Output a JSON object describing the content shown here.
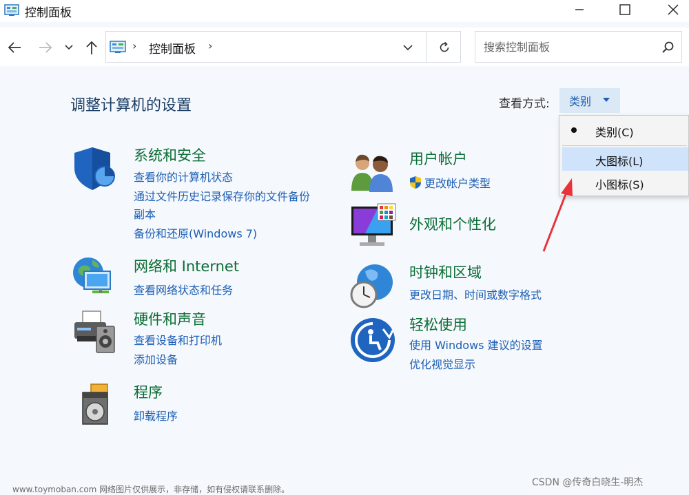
{
  "window": {
    "title": "控制面板"
  },
  "address": {
    "crumbs": [
      "控制面板"
    ]
  },
  "search": {
    "placeholder": "搜索控制面板"
  },
  "main": {
    "heading": "调整计算机的设置",
    "view_by_label": "查看方式:",
    "view_by_value": "类别"
  },
  "menu": {
    "items": [
      {
        "label": "类别(C)",
        "selected": true
      },
      {
        "label": "大图标(L)",
        "highlighted": true
      },
      {
        "label": "小图标(S)"
      }
    ]
  },
  "categories": [
    {
      "title": "系统和安全",
      "icon": "shield-icon",
      "links": [
        "查看你的计算机状态",
        "通过文件历史记录保存你的文件备份",
        "副本",
        "备份和还原(Windows 7)"
      ]
    },
    {
      "title": "网络和 Internet",
      "icon": "network-icon",
      "links": [
        "查看网络状态和任务"
      ]
    },
    {
      "title": "硬件和声音",
      "icon": "printer-icon",
      "links": [
        "查看设备和打印机",
        "添加设备"
      ]
    },
    {
      "title": "程序",
      "icon": "programs-icon",
      "links": [
        "卸载程序"
      ]
    },
    {
      "title": "用户帐户",
      "icon": "users-icon",
      "links": [
        "更改帐户类型"
      ]
    },
    {
      "title": "外观和个性化",
      "icon": "monitor-icon",
      "links": []
    },
    {
      "title": "时钟和区域",
      "icon": "clock-globe-icon",
      "links": [
        "更改日期、时间或数字格式"
      ]
    },
    {
      "title": "轻松使用",
      "icon": "accessibility-icon",
      "links": [
        "使用 Windows 建议的设置",
        "优化视觉显示"
      ]
    }
  ],
  "colors": {
    "link": "#1d5fb4",
    "category_title": "#0b6e35",
    "accent": "#1d5fb4",
    "annotation_arrow": "#e8333b"
  },
  "watermarks": {
    "left": "www.toymoban.com 网络图片仅供展示，非存储，如有侵权请联系删除。",
    "right": "CSDN @传奇白晓生-明杰"
  }
}
